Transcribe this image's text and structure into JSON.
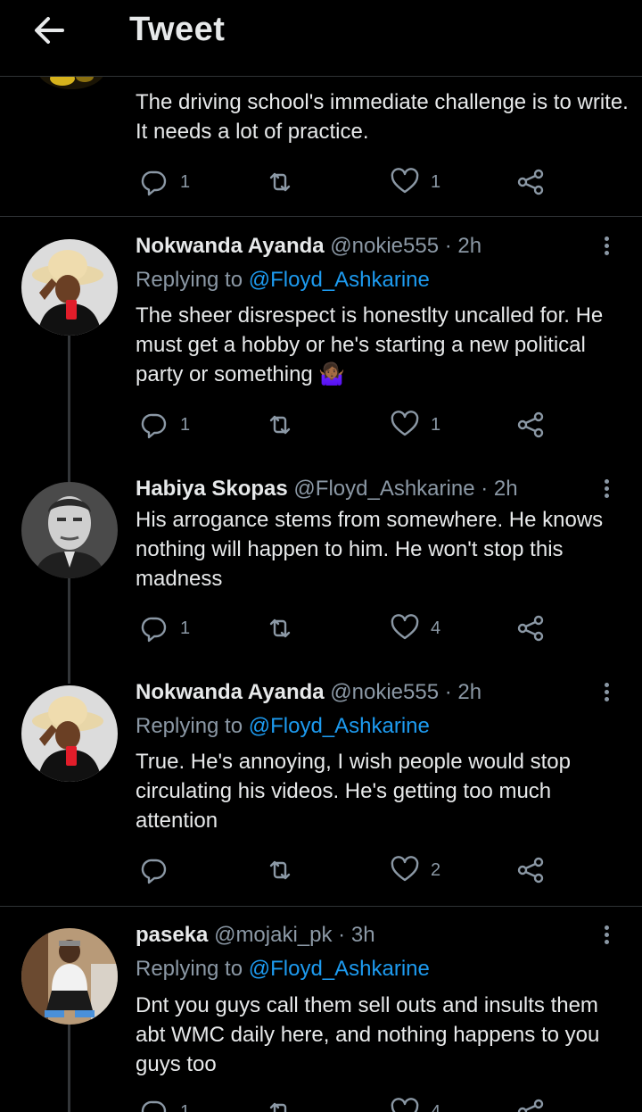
{
  "header": {
    "title": "Tweet",
    "back_icon": "arrow-left-icon"
  },
  "top_tweet": {
    "text": "The driving school's immediate challenge is to write. It needs a lot of practice.",
    "replies": "1",
    "retweets": "",
    "likes": "1"
  },
  "tweets": [
    {
      "name": "Nokwanda Ayanda",
      "handle": "@nokie555",
      "dot": "·",
      "time": "2h",
      "replying_prefix": "Replying to",
      "replying_to": "@Floyd_Ashkarine",
      "text": "The sheer disrespect is honestlty uncalled for. He must get a hobby or he's starting a new political party or something 🤷🏾‍♀️",
      "replies": "1",
      "retweets": "",
      "likes": "1"
    },
    {
      "name": "Habiya Skopas",
      "handle": "@Floyd_Ashkarine",
      "dot": "·",
      "time": "2h",
      "text": "His arrogance stems from somewhere. He knows nothing will happen to him. He won't stop this madness",
      "replies": "1",
      "retweets": "",
      "likes": "4"
    },
    {
      "name": "Nokwanda Ayanda",
      "handle": "@nokie555",
      "dot": "·",
      "time": "2h",
      "replying_prefix": "Replying to",
      "replying_to": "@Floyd_Ashkarine",
      "text": "True. He's annoying, I wish people would stop circulating his videos. He's getting too much attention",
      "replies": "",
      "retweets": "",
      "likes": "2"
    },
    {
      "name": "paseka",
      "handle": "@mojaki_pk",
      "dot": "·",
      "time": "3h",
      "replying_prefix": "Replying to",
      "replying_to": "@Floyd_Ashkarine",
      "text": "Dnt you guys call them sell outs and insults them abt WMC daily here, and nothing happens to you guys too",
      "replies": "1",
      "retweets": "",
      "likes": "4"
    }
  ],
  "colors": {
    "background": "#000000",
    "text": "#e7e9ea",
    "muted": "#8b98a5",
    "link": "#1d9bf0",
    "divider": "#2f3336"
  },
  "icons": [
    "arrow-left-icon",
    "reply-icon",
    "retweet-icon",
    "like-icon",
    "share-icon",
    "more-icon"
  ]
}
